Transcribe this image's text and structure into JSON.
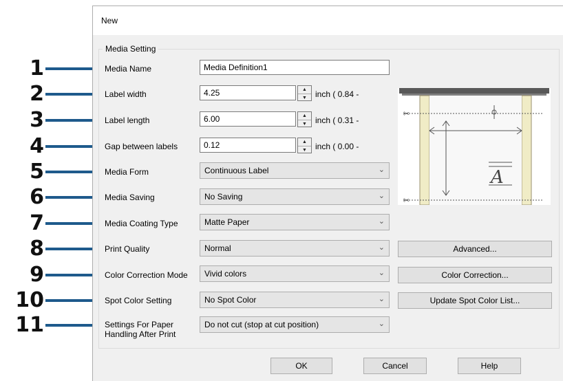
{
  "window": {
    "title": "New"
  },
  "group": {
    "legend": "Media Setting"
  },
  "callouts": [
    "1",
    "2",
    "3",
    "4",
    "5",
    "6",
    "7",
    "8",
    "9",
    "10",
    "11"
  ],
  "fields": {
    "media_name": {
      "label": "Media Name",
      "value": "Media Definition1"
    },
    "label_width": {
      "label": "Label width",
      "value": "4.25",
      "unit": "inch ( 0.84 -"
    },
    "label_length": {
      "label": "Label length",
      "value": "6.00",
      "unit": "inch ( 0.31 -"
    },
    "gap": {
      "label": "Gap between labels",
      "value": "0.12",
      "unit": "inch ( 0.00 -"
    },
    "media_form": {
      "label": "Media Form",
      "value": "Continuous Label"
    },
    "media_saving": {
      "label": "Media Saving",
      "value": "No Saving"
    },
    "media_coating": {
      "label": "Media Coating Type",
      "value": "Matte Paper"
    },
    "print_quality": {
      "label": "Print Quality",
      "value": "Normal"
    },
    "color_correction": {
      "label": "Color Correction Mode",
      "value": "Vivid colors"
    },
    "spot_color": {
      "label": "Spot Color Setting",
      "value": "No Spot Color"
    },
    "paper_handling": {
      "label_line1": "Settings For Paper",
      "label_line2": "Handling After Print",
      "value": "Do not cut (stop at cut position)"
    }
  },
  "buttons": {
    "advanced": "Advanced...",
    "color_correction": "Color Correction...",
    "update_spot": "Update Spot Color List...",
    "ok": "OK",
    "cancel": "Cancel",
    "help": "Help"
  },
  "preview": {
    "glyph": "A"
  },
  "colors": {
    "callout": "#1e5a8c",
    "roll": "#f0ecc6",
    "shaft": "#595959"
  }
}
